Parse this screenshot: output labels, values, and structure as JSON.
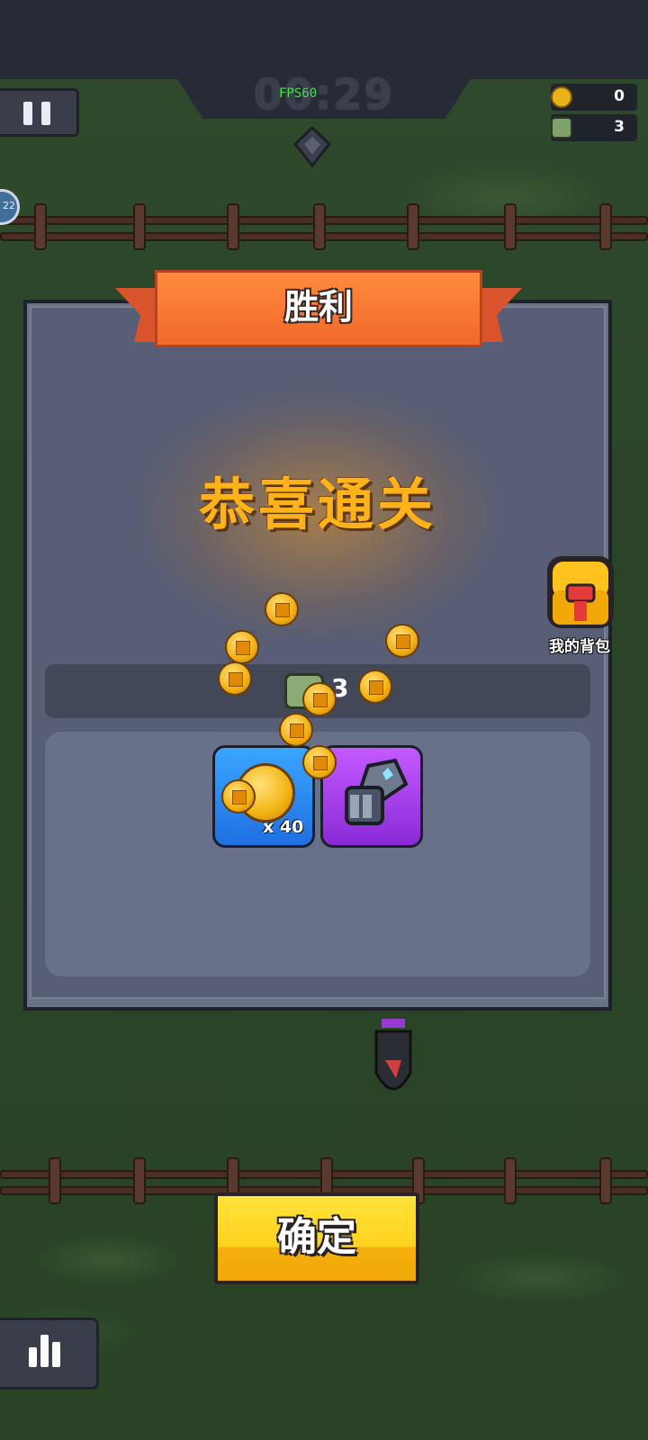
{
  "hud": {
    "timer": "00:29",
    "fps": "FPS60",
    "coins": "0",
    "kills": "3",
    "level_badge": "22"
  },
  "dialog": {
    "title": "胜利",
    "headline": "恭喜通关",
    "kill_count": "3",
    "rewards": [
      {
        "icon": "gold-coin-icon",
        "quantity": "x 40"
      },
      {
        "icon": "robot-gauntlet-icon",
        "quantity": ""
      }
    ]
  },
  "backpack": {
    "label": "我的背包"
  },
  "confirm": {
    "label": "确定"
  },
  "colors": {
    "ribbon": "#f0692b",
    "headline": "#ffb21a",
    "confirm": "#ffd21e",
    "panel": "#575e75"
  }
}
